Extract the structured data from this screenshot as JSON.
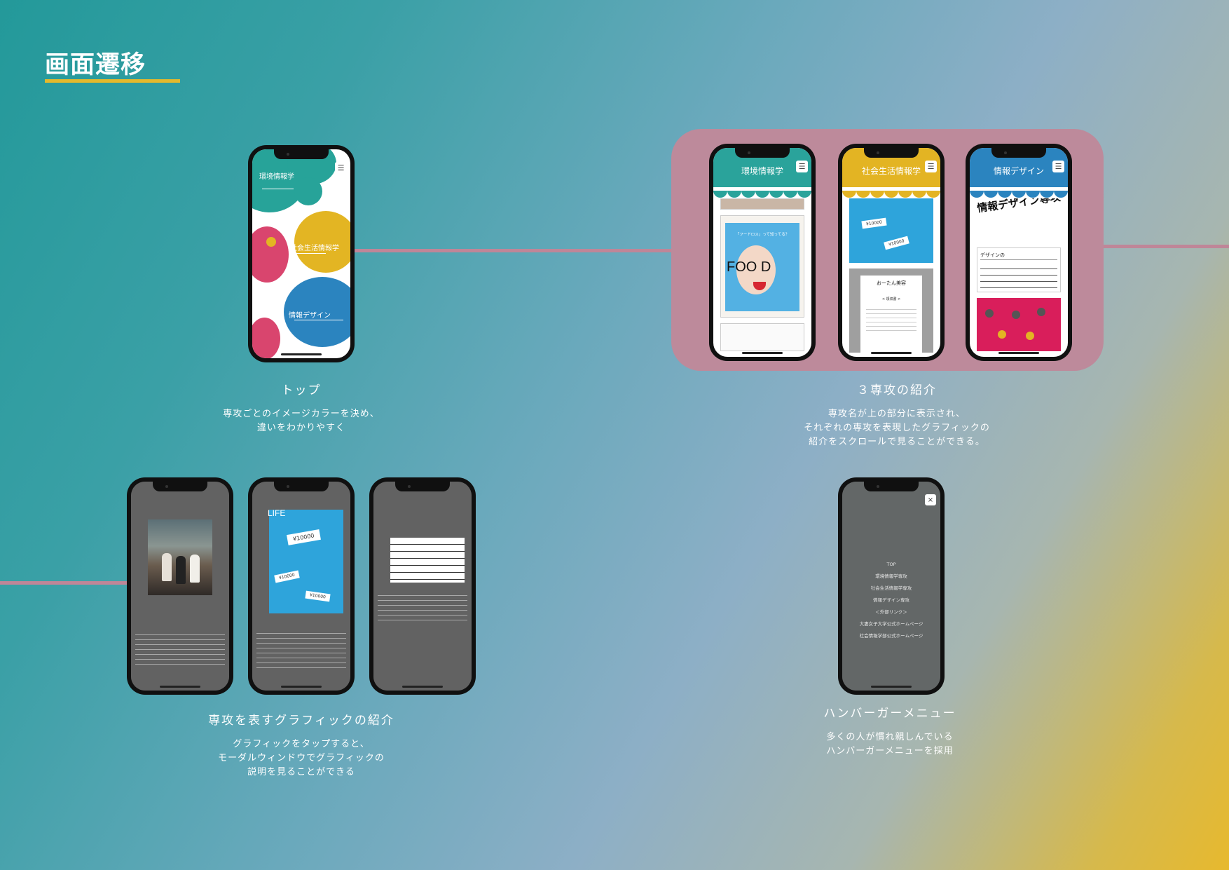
{
  "page": {
    "title": "画面遷移",
    "accent": "#e4b92c",
    "connector_color": "#bf8698"
  },
  "top": {
    "caption_title": "トップ",
    "caption_desc_1": "専攻ごとのイメージカラーを決め、",
    "caption_desc_2": "違いをわかりやすく",
    "labels": [
      "環境情報学",
      "社会生活情報学",
      "情報デザイン"
    ],
    "menu_icon": "hamburger-icon"
  },
  "majors": {
    "caption_title": "３専攻の紹介",
    "caption_desc_1": "専攻名が上の部分に表示され、",
    "caption_desc_2": "それぞれの専攻を表現したグラフィックの",
    "caption_desc_3": "紹介をスクロールで見ることができる。",
    "screens": [
      {
        "name": "環境情報学",
        "color": "#2aa39b",
        "poster_heading": "「フードロス」って知ってる？",
        "poster_text": "FOO D"
      },
      {
        "name": "社会生活情報学",
        "color": "#e3b423",
        "card_text": "¥10000",
        "receipt_title": "おーたん美容",
        "receipt_sub": "< 領収書 >"
      },
      {
        "name": "情報デザイン",
        "color": "#2b84bf",
        "pattern_text": "情報デザイン専攻",
        "note_text": "デザインの"
      }
    ]
  },
  "graphics": {
    "caption_title": "専攻を表すグラフィックの紹介",
    "caption_desc_1": "グラフィックをタップすると、",
    "caption_desc_2": "モーダルウィンドウでグラフィックの",
    "caption_desc_3": "説明を見ることができる",
    "modal_2_label": "LIFE",
    "modal_2_bill": "¥10000"
  },
  "hamburger": {
    "caption_title": "ハンバーガーメニュー",
    "caption_desc_1": "多くの人が慣れ親しんでいる",
    "caption_desc_2": "ハンバーガーメニューを採用",
    "items": [
      "TOP",
      "環境情報学専攻",
      "社会生活情報学専攻",
      "情報デザイン専攻",
      "＜外部リンク＞",
      "大妻女子大学公式ホームページ",
      "社会情報学部公式ホームページ"
    ],
    "close_label": "×"
  }
}
